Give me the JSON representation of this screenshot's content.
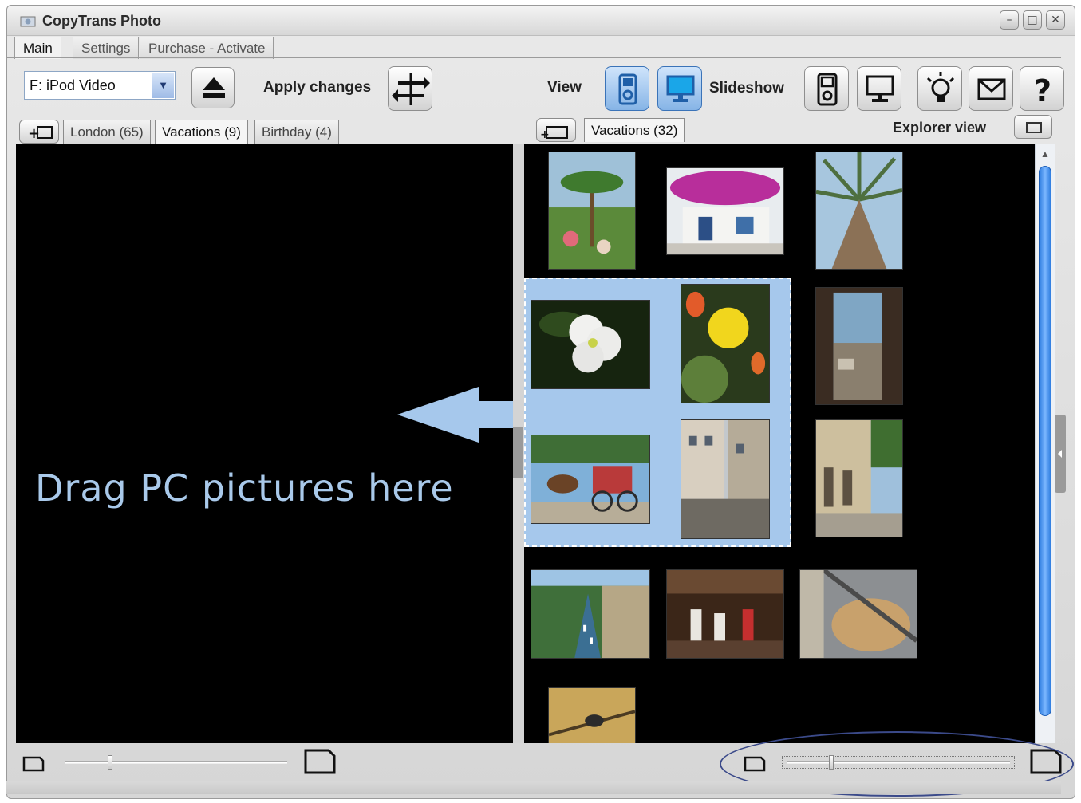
{
  "window": {
    "title": "CopyTrans Photo",
    "minimize_glyph": "–",
    "maximize_glyph": "□",
    "close_glyph": "✕"
  },
  "tabs": [
    "Main",
    "Settings",
    "Purchase - Activate"
  ],
  "toolbar": {
    "device": "F: iPod Video",
    "apply_label": "Apply changes",
    "view_label": "View",
    "slideshow_label": "Slideshow"
  },
  "left_albums": [
    "London (65)",
    "Vacations (9)",
    "Birthday (4)"
  ],
  "right_albums": [
    "Vacations (32)"
  ],
  "explorer_label": "Explorer view",
  "drop_hint": "Drag PC pictures here",
  "sliders": {
    "left_zoom": 0.2,
    "right_zoom": 0.2
  },
  "icons": {
    "eject": "eject-icon",
    "apply": "swap-arrows-icon",
    "view_ipod": "ipod-icon",
    "view_pc": "monitor-icon",
    "slideshow_ipod": "ipod-slideshow-icon",
    "slideshow_pc": "monitor-slideshow-icon",
    "tips": "lightbulb-icon",
    "mail": "envelope-icon",
    "help": "question-icon"
  },
  "colors": {
    "accent": "#a6c8ec",
    "drop_text": "#a9c9ea",
    "scroll": "#2f7de0"
  }
}
